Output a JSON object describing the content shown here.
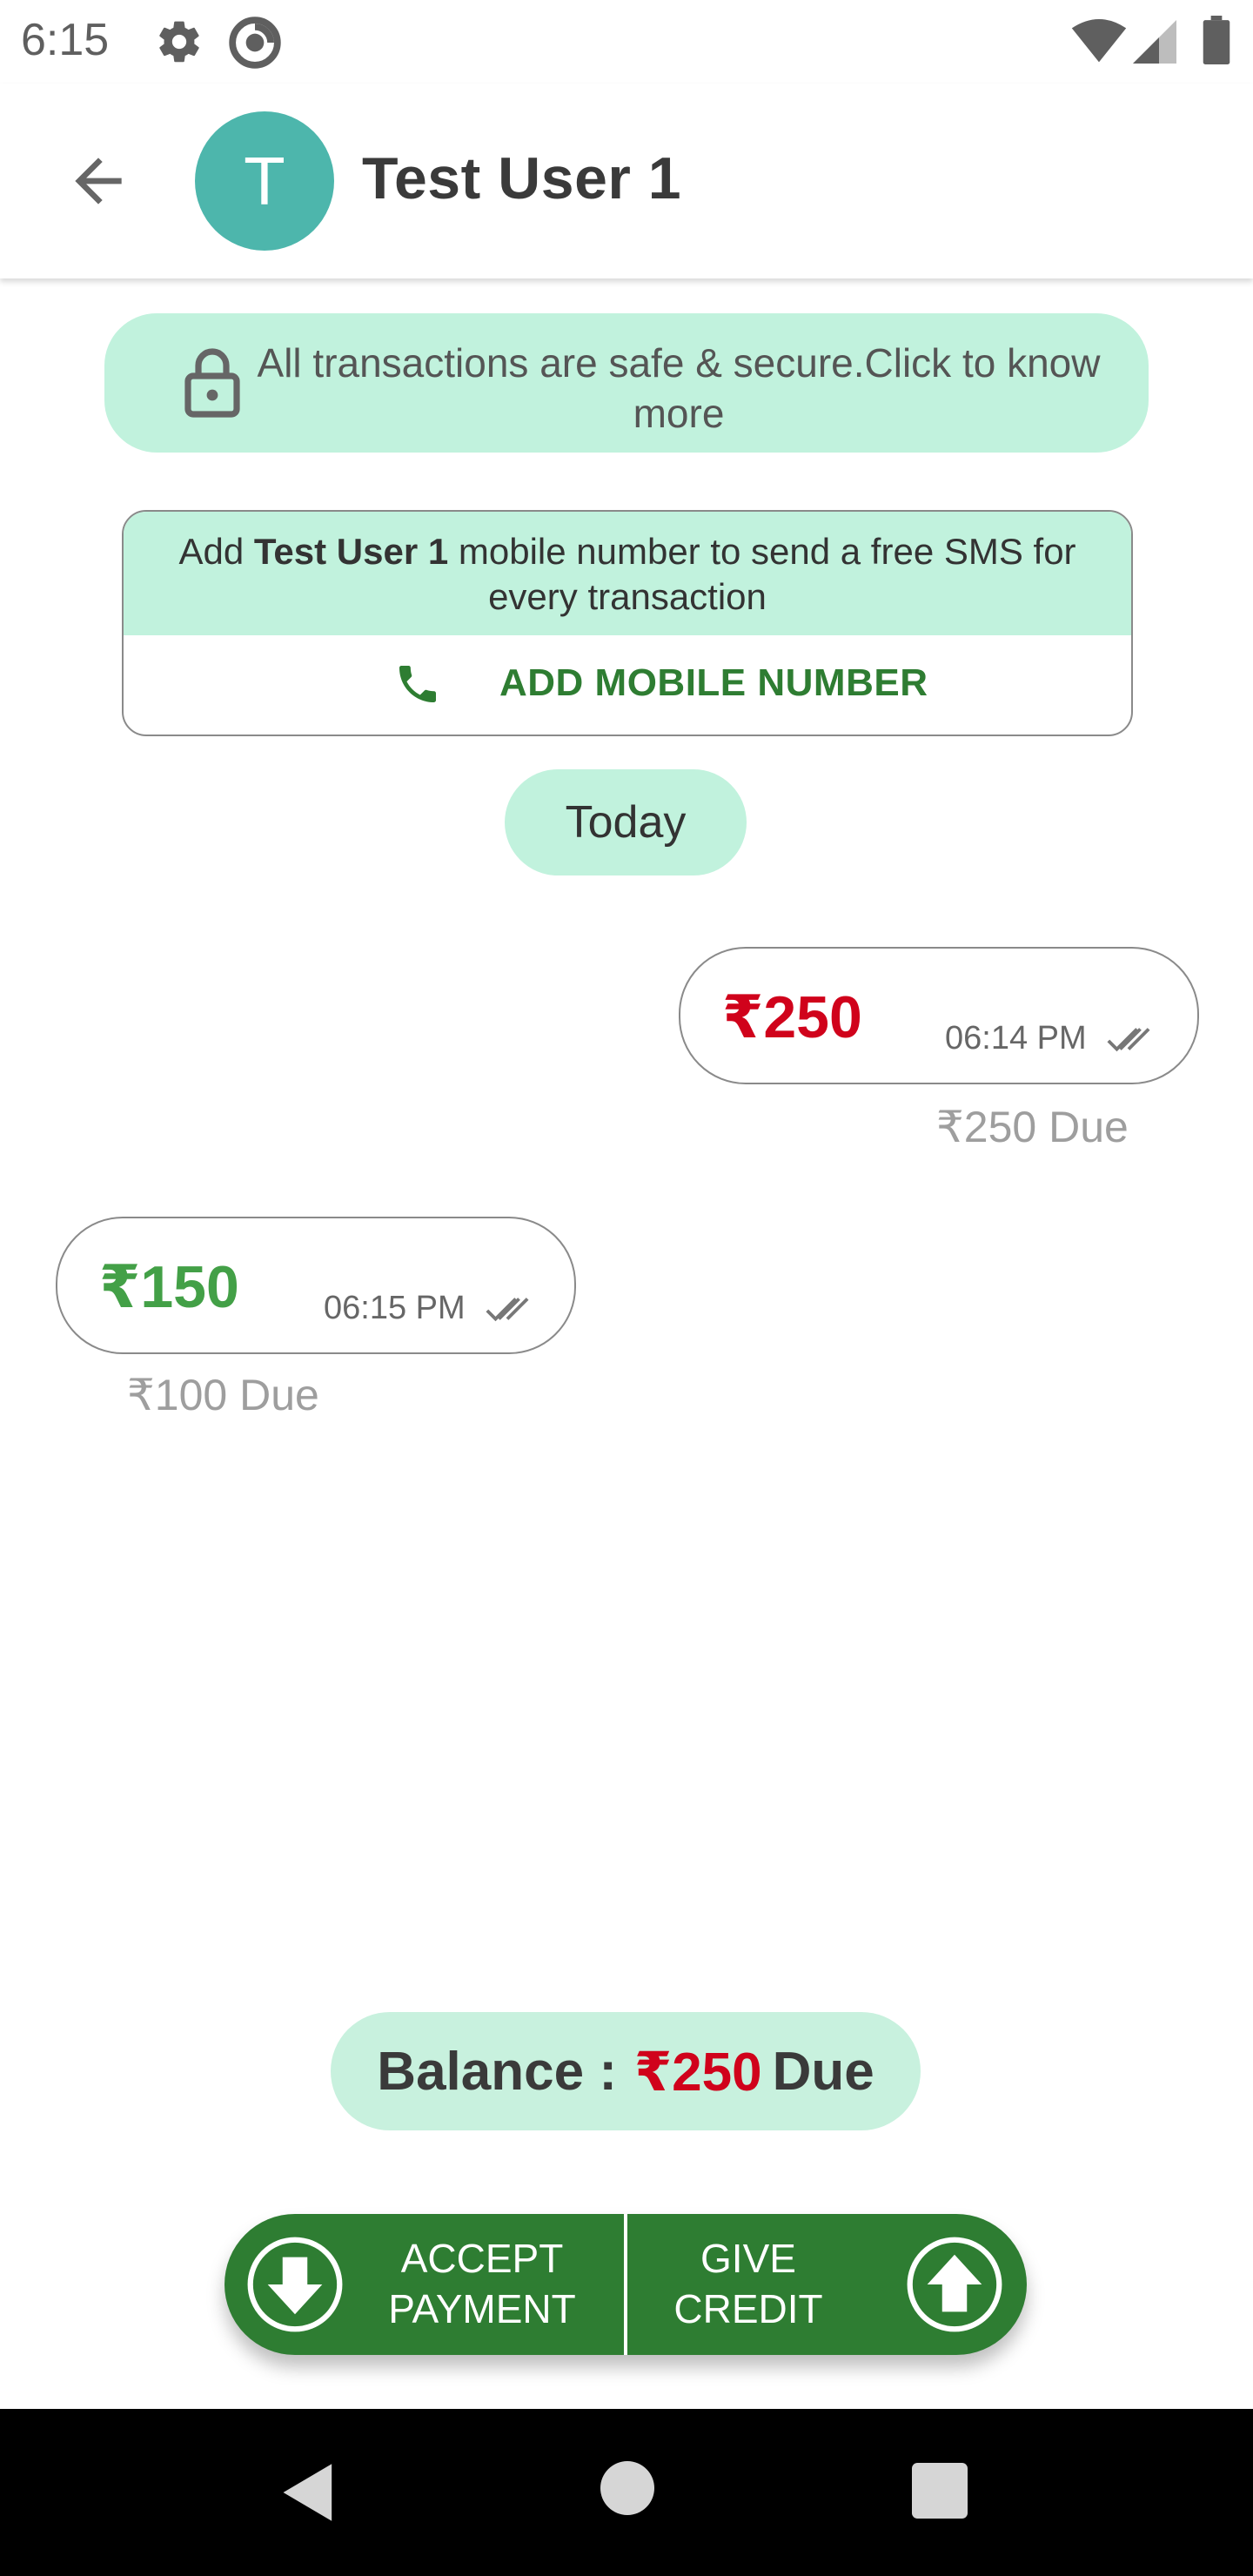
{
  "status_bar": {
    "time": "6:15",
    "icons": [
      "gear-icon",
      "sync-icon",
      "wifi-icon",
      "signal-icon",
      "battery-icon"
    ]
  },
  "header": {
    "avatar_initial": "T",
    "contact_name": "Test User 1",
    "avatar_color": "#4db6ac"
  },
  "secure_banner": {
    "text": "All transactions are safe & secure.Click to know more"
  },
  "add_mobile_card": {
    "text_prefix": "Add ",
    "text_name": "Test User 1",
    "text_suffix": " mobile number to send a free SMS for every transaction",
    "button_label": "ADD MOBILE NUMBER"
  },
  "date_chip": "Today",
  "transactions": [
    {
      "amount": "₹250",
      "time": "06:14 PM",
      "due": "₹250 Due",
      "type": "credit",
      "color": "#d0021b"
    },
    {
      "amount": "₹150",
      "time": "06:15 PM",
      "due": "₹100 Due",
      "type": "payment",
      "color": "#43a047"
    }
  ],
  "balance": {
    "label": "Balance :",
    "amount": "₹250",
    "suffix": "Due"
  },
  "actions": {
    "accept_label": "ACCEPT PAYMENT",
    "give_label": "GIVE CREDIT"
  },
  "colors": {
    "accent_green": "#2e7d32",
    "mint": "#c1f2dd",
    "due_red": "#d0021b"
  }
}
